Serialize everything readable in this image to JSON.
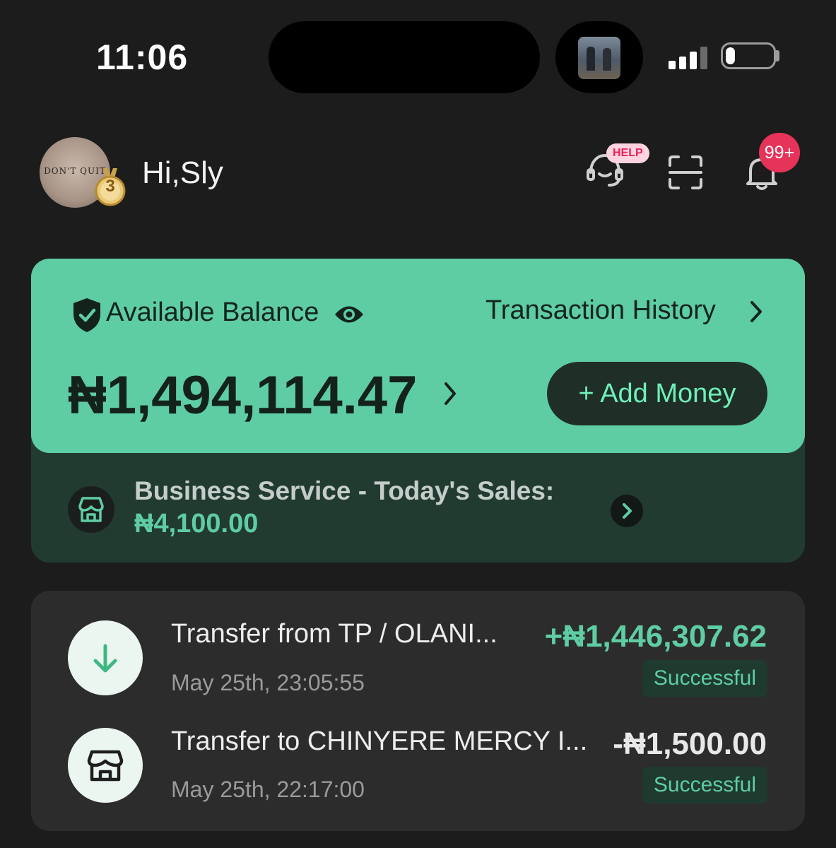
{
  "status_bar": {
    "time": "11:06",
    "battery_level": 0.2
  },
  "header": {
    "greeting": "Hi,Sly",
    "avatar_text": "DON'T QUIT",
    "medal_level": "3",
    "help_badge": "HELP",
    "notification_count": "99+"
  },
  "balance_card": {
    "label": "Available Balance",
    "transaction_history_label": "Transaction History",
    "balance": "₦1,494,114.47",
    "add_money_label": "+ Add Money",
    "business_label": "Business Service - Today's Sales:",
    "business_amount": "₦4,100.00"
  },
  "transactions": [
    {
      "title": "Transfer from TP / OLANI...",
      "date": "May 25th, 23:05:55",
      "amount": "+₦1,446,307.62",
      "status": "Successful",
      "icon": "arrow-down-icon"
    },
    {
      "title": "Transfer to CHINYERE MERCY I...",
      "date": "May 25th, 22:17:00",
      "amount": "-₦1,500.00",
      "status": "Successful",
      "icon": "store-icon"
    }
  ],
  "colors": {
    "accent": "#5fcda3",
    "background": "#1c1c1c",
    "badge": "#e6335a"
  }
}
